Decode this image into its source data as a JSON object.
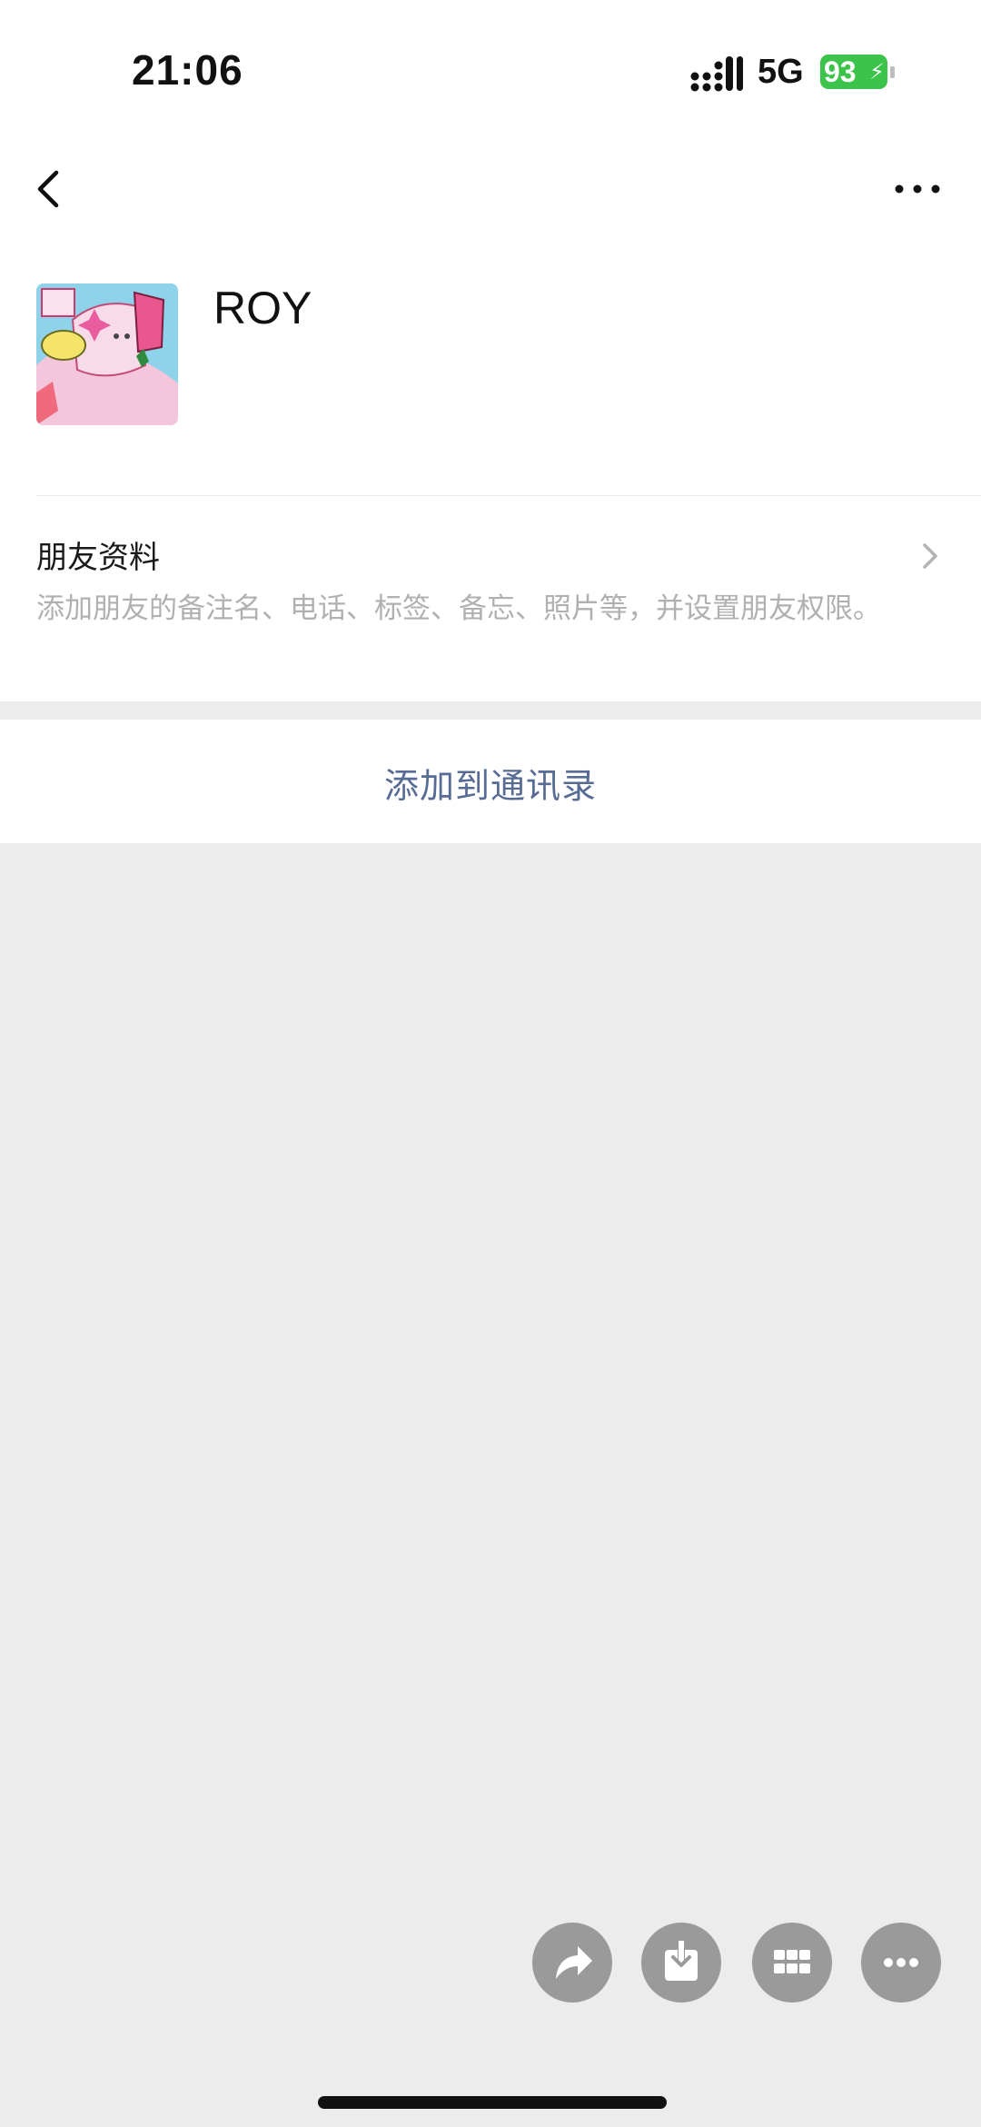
{
  "status_bar": {
    "time": "21:06",
    "network": "5G",
    "battery": "93",
    "battery_color": "#3cc34a"
  },
  "nav": {
    "back_icon": "chevron-left-icon",
    "more_icon": "ellipsis-icon"
  },
  "profile": {
    "name": "ROY",
    "avatar": "cartoon-avatar-image"
  },
  "friend_info": {
    "title": "朋友资料",
    "description": "添加朋友的备注名、电话、标签、备忘、照片等，并设置朋友权限。",
    "chevron_icon": "chevron-right-icon"
  },
  "actions": {
    "add_to_contacts": "添加到通讯录",
    "link_color": "#576b95"
  },
  "floating_actions": [
    {
      "icon": "share-icon"
    },
    {
      "icon": "save-download-icon"
    },
    {
      "icon": "grid-icon"
    },
    {
      "icon": "more-icon"
    }
  ]
}
